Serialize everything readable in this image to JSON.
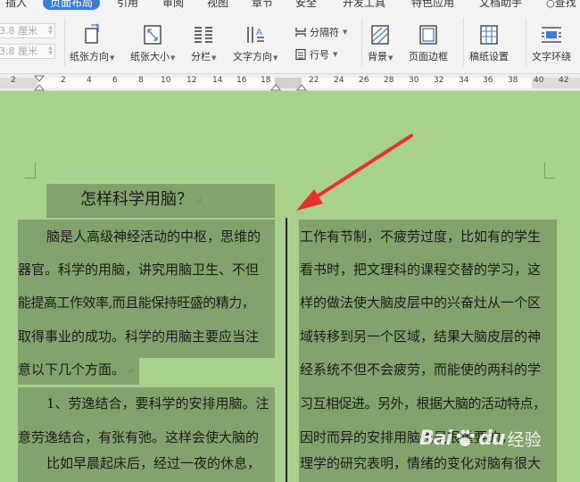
{
  "tabs": [
    {
      "label": "插入",
      "active": false
    },
    {
      "label": "页面布局",
      "active": true
    },
    {
      "label": "引用",
      "active": false
    },
    {
      "label": "审阅",
      "active": false
    },
    {
      "label": "视图",
      "active": false
    },
    {
      "label": "章节",
      "active": false
    },
    {
      "label": "安全",
      "active": false
    },
    {
      "label": "开发工具",
      "active": false
    },
    {
      "label": "特色应用",
      "active": false
    },
    {
      "label": "文档助手",
      "active": false
    },
    {
      "label": "查找",
      "active": false
    }
  ],
  "ribbon": {
    "spin_top_value": "3.8 厘米",
    "spin_bottom_value": "3.8 厘米",
    "paper_orientation": "纸张方向",
    "paper_size": "纸张大小",
    "columns": "分栏",
    "text_direction": "文字方向",
    "separator": "分隔符",
    "line_number": "行号",
    "background": "背景",
    "page_border": "页面边框",
    "draft_paper": "稿纸设置",
    "text_wrap": "文字环绕"
  },
  "ruler": {
    "ticks": [
      "2",
      "2",
      "4",
      "6",
      "8",
      "10",
      "12",
      "14",
      "16",
      "18",
      "22",
      "24",
      "26",
      "28",
      "30",
      "32",
      "34",
      "36",
      "38",
      "40",
      "42"
    ]
  },
  "document": {
    "title": "怎样科学用脑？",
    "paragraph_mark": "↵",
    "left_lines": [
      "脑是人高级神经活动的中枢，思维的",
      "器官。科学的用脑，讲究用脑卫生、不但",
      "能提高工作效率,而且能保持旺盛的精力，",
      "取得事业的成功。科学的用脑主要应当注",
      "意以下几个方面。",
      "1、劳逸结合，要科学的安排用脑。注",
      "意劳逸结合，有张有弛。这样会使大脑的",
      "比如早晨起床后，经过一夜的休息，"
    ],
    "right_lines": [
      "工作有节制，不疲劳过度，比如有的学生",
      "看书时，把文理科的课程交替的学习，这",
      "样的做法使大脑皮层中的兴奋灶从一个区",
      "域转移到另一个区域，结果大脑皮层的神",
      "经系统不但不会疲劳，而能使的两科的学",
      "习互相促进。另外，根据大脑的活动特点，",
      "因时而异的安排用脑也是很重要的，",
      "理学的研究表明，情绪的变化对脑有很大"
    ]
  },
  "watermark": {
    "brand": "Bai",
    "brand2": "du",
    "sub": "经验"
  },
  "colors": {
    "page_bg": "#a9d18e",
    "highlight": "#82a46c",
    "arrow": "#e8312a",
    "active_tab": "#3b7ddd"
  }
}
